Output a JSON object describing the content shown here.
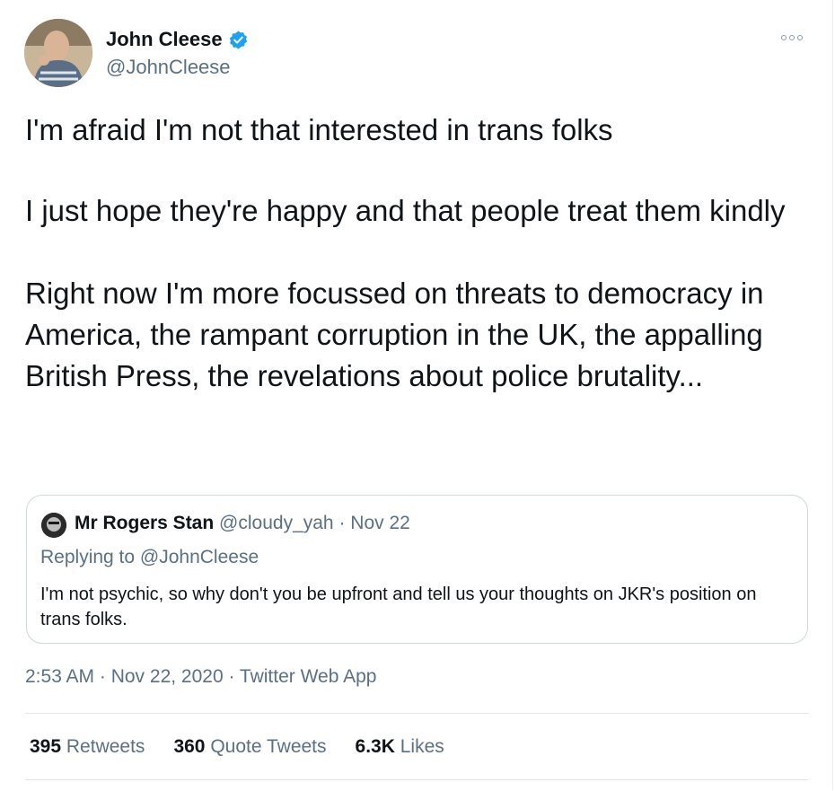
{
  "author": {
    "name": "John Cleese",
    "handle": "@JohnCleese",
    "verified": true,
    "avatar_icon": "profile-photo"
  },
  "tweet": {
    "paragraphs": [
      "I'm afraid I'm not that interested in trans folks",
      "I just hope they're happy and that people treat them kindly",
      "Right now I'm more focussed on threats to democracy in America, the rampant corruption in the UK, the appalling British Press, the revelations about police brutality..."
    ],
    "timestamp": "2:53 AM · Nov 22, 2020 · Twitter Web App"
  },
  "quoted": {
    "name": "Mr Rogers Stan",
    "handle": "@cloudy_yah",
    "date": "Nov 22",
    "replying_prefix": "Replying to",
    "replying_to": "@JohnCleese",
    "text": "I'm not psychic, so why don't you be upfront and tell us your thoughts on JKR's position on trans folks."
  },
  "stats": [
    {
      "count": "395",
      "label": "Retweets"
    },
    {
      "count": "360",
      "label": "Quote Tweets"
    },
    {
      "count": "6.3K",
      "label": "Likes"
    }
  ],
  "colors": {
    "text": "#0f1419",
    "secondary": "#5b7083",
    "verified": "#1da1f2",
    "border": "#cfd9de"
  }
}
